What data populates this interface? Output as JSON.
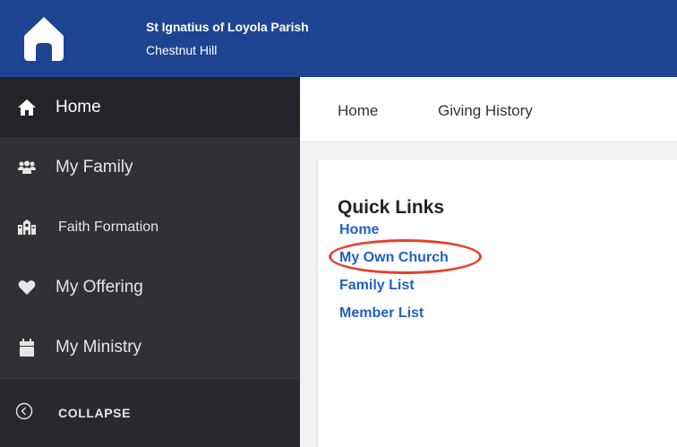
{
  "header": {
    "parish_name": "St Ignatius of Loyola Parish",
    "parish_location": "Chestnut Hill",
    "logo_icon": "church-home-icon",
    "background_color": "#1d4591"
  },
  "sidebar": {
    "items": [
      {
        "label": "Home",
        "icon": "home-icon",
        "active": true
      },
      {
        "label": "My Family",
        "icon": "family-icon"
      },
      {
        "label": "Faith Formation",
        "icon": "school-icon"
      },
      {
        "label": "My Offering",
        "icon": "heart-icon"
      },
      {
        "label": "My Ministry",
        "icon": "calendar-icon"
      }
    ],
    "collapse_label": "COLLAPSE",
    "collapse_icon": "chevron-left-circle-icon"
  },
  "tabs": [
    {
      "label": "Home"
    },
    {
      "label": "Giving History"
    }
  ],
  "quick_links": {
    "title": "Quick Links",
    "links": [
      "Home",
      "My Own Church",
      "Family List",
      "Member List"
    ],
    "highlighted": "My Own Church",
    "link_color": "#2260c4",
    "annotation_color": "#e5412b"
  }
}
